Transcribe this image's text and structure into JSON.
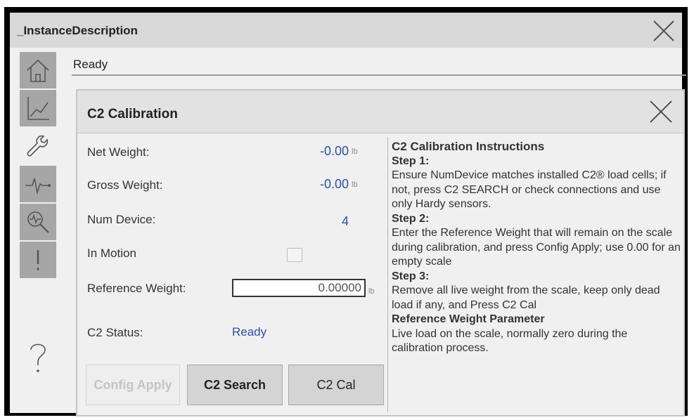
{
  "window": {
    "title": "_InstanceDescription"
  },
  "sidebar": {
    "items": [
      {
        "icon": "home-icon"
      },
      {
        "icon": "trend-icon"
      },
      {
        "icon": "wrench-icon",
        "active": true
      },
      {
        "icon": "pulse-icon"
      },
      {
        "icon": "diagnostics-icon"
      },
      {
        "icon": "alarm-icon"
      },
      {
        "icon": "help-icon"
      }
    ]
  },
  "status": {
    "text": "Ready"
  },
  "panel": {
    "title": "C2 Calibration",
    "fields": {
      "net_weight": {
        "label": "Net Weight:",
        "value": "-0.00",
        "unit": "lb"
      },
      "gross_weight": {
        "label": "Gross Weight:",
        "value": "-0.00",
        "unit": "lb"
      },
      "num_device": {
        "label": "Num Device:",
        "value": "4"
      },
      "in_motion": {
        "label": "In Motion",
        "checked": false
      },
      "reference_weight": {
        "label": "Reference Weight:",
        "value": "0.00000",
        "unit": "lb"
      },
      "c2_status": {
        "label": "C2 Status:",
        "value": "Ready"
      }
    },
    "buttons": {
      "config_apply": "Config Apply",
      "c2_search": "C2 Search",
      "c2_cal": "C2 Cal"
    },
    "instructions": {
      "heading": "C2 Calibration Instructions",
      "step1_title": "Step 1:",
      "step1_text": "Ensure NumDevice matches installed C2® load cells; if not, press C2 SEARCH or check connections and use only Hardy sensors.",
      "step2_title": "Step 2:",
      "step2_text": "Enter the Reference Weight that will remain on the scale during calibration, and press Config Apply; use 0.00 for an empty scale",
      "step3_title": "Step 3:",
      "step3_text": "Remove all live weight from the scale, keep only dead load if any, and Press C2 Cal",
      "param_title": "Reference Weight Parameter",
      "param_text": "Live load on the scale, normally zero during the calibration process."
    }
  }
}
